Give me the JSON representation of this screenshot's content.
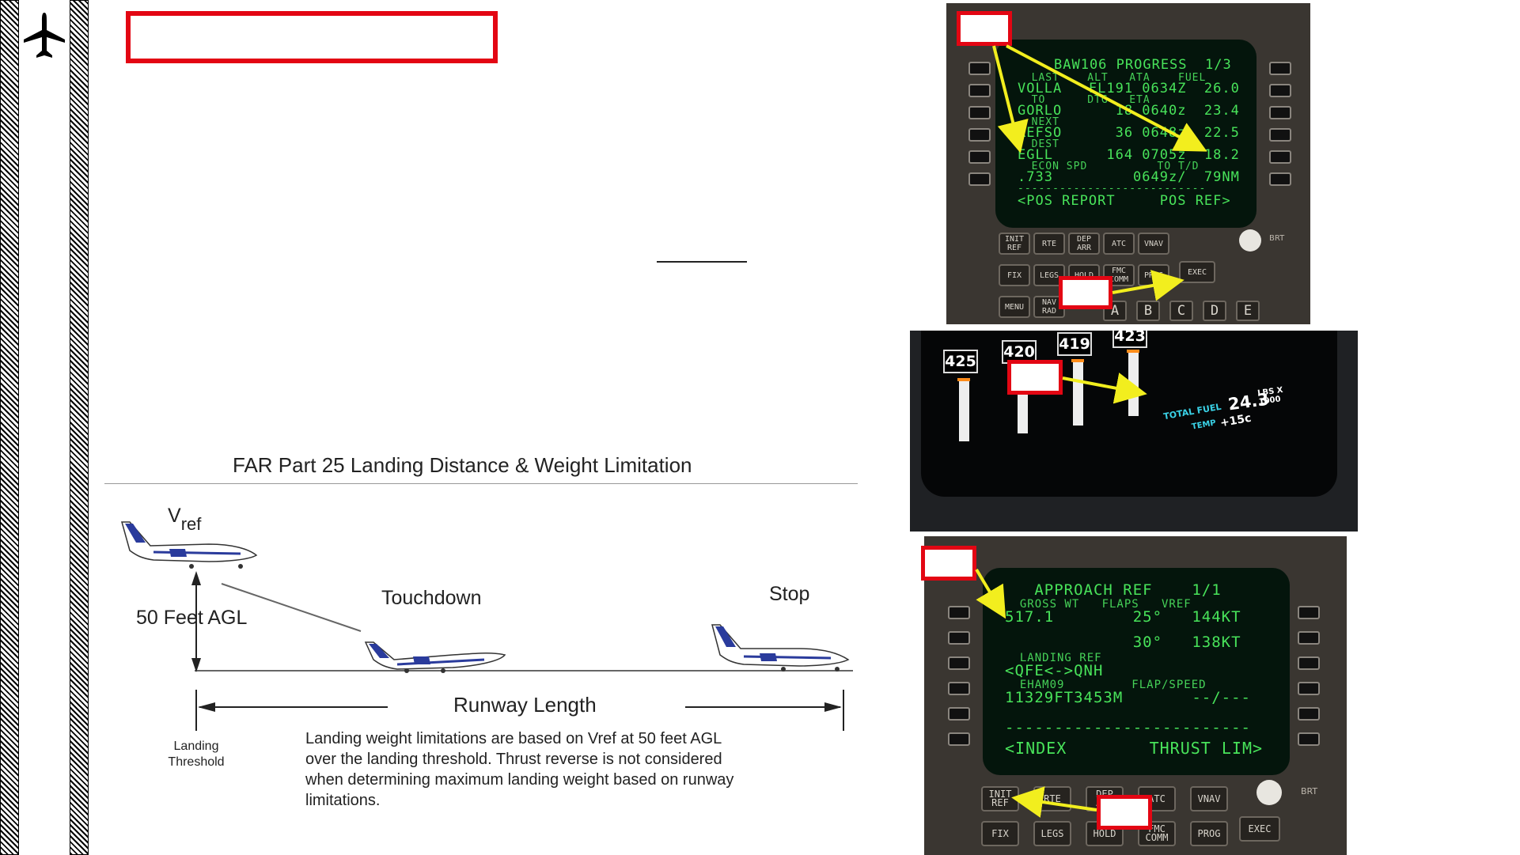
{
  "sidebar": {
    "logo_icon": "airplane-icon"
  },
  "diagram": {
    "title": "FAR Part 25 Landing Distance & Weight Limitation",
    "vref_main": "V",
    "vref_sub": "ref",
    "agl_label": "50 Feet AGL",
    "touchdown_label": "Touchdown",
    "stop_label": "Stop",
    "runway_label": "Runway Length",
    "threshold_label_1": "Landing",
    "threshold_label_2": "Threshold",
    "description": [
      "Landing weight limitations are based on Vref at 50 feet AGL",
      "over the landing threshold.   Thrust reverse is not considered",
      "when determining maximum landing weight based on runway",
      "limitations."
    ]
  },
  "progress_cdu": {
    "lines": [
      {
        "text": "BAW106 PROGRESS  1/3",
        "size": "big"
      },
      {
        "text": "  LAST    ALT   ATA    FUEL",
        "size": "small"
      },
      {
        "text": "VOLLA   FL191 0634Z  26.0",
        "size": "big"
      },
      {
        "text": "  TO      DTG   ETA",
        "size": "small"
      },
      {
        "text": "GORLO      18 0640z  23.4",
        "size": "big"
      },
      {
        "text": "  NEXT",
        "size": "small"
      },
      {
        "text": "REFSO      36 0648z  22.5",
        "size": "big"
      },
      {
        "text": "  DEST",
        "size": "small"
      },
      {
        "text": "EGLL      164 0705z  18.2",
        "size": "big"
      },
      {
        "text": "  ECON SPD          TO T/D",
        "size": "small"
      },
      {
        "text": ".733         0649z/  79NM",
        "size": "big"
      },
      {
        "text": "---------------------------",
        "size": "small"
      },
      {
        "text": "<POS REPORT     POS REF>",
        "size": "big"
      }
    ],
    "keys_row1": [
      "INIT\nREF",
      "RTE",
      "DEP\nARR",
      "ATC",
      "VNAV"
    ],
    "keys_row2": [
      "FIX",
      "LEGS",
      "HOLD",
      "FMC\nCOMM",
      "PROG"
    ],
    "keys_row3": [
      "MENU",
      "NAV\nRAD"
    ],
    "exec_label": "EXEC",
    "brt_label": "BRT",
    "letters": [
      "A",
      "B",
      "C",
      "D",
      "E"
    ]
  },
  "eicas": {
    "fuel_flows": [
      "425",
      "420",
      "419",
      "423"
    ],
    "total_fuel_label": "TOTAL FUEL",
    "total_fuel_value": "24.3",
    "units_1": "LBS X",
    "units_2": "1000",
    "temp_label": "TEMP",
    "temp_value": "+15c"
  },
  "approach_cdu": {
    "lines": [
      {
        "text": "   APPROACH REF    1/1",
        "size": "big"
      },
      {
        "text": "  GROSS WT   FLAPS   VREF",
        "size": "small"
      },
      {
        "text": "517.1        25°   144KT",
        "size": "big"
      },
      {
        "text": " ",
        "size": "small"
      },
      {
        "text": "             30°   138KT",
        "size": "big"
      },
      {
        "text": "  LANDING REF",
        "size": "small"
      },
      {
        "text": "<QFE<->QNH",
        "size": "big"
      },
      {
        "text": "  EHAM09         FLAP/SPEED",
        "size": "small"
      },
      {
        "text": "11329FT3453M       --/---",
        "size": "big"
      },
      {
        "text": " ",
        "size": "small"
      },
      {
        "text": "-------------------------",
        "size": "big"
      },
      {
        "text": "<INDEX        THRUST LIM>",
        "size": "big"
      }
    ],
    "keys_row1": [
      "INIT\nREF",
      "RTE",
      "DEP\nARR",
      "ATC",
      "VNAV"
    ],
    "keys_row2": [
      "FIX",
      "LEGS",
      "HOLD",
      "FMC\nCOMM",
      "PROG"
    ],
    "exec_label": "EXEC",
    "brt_label": "BRT"
  },
  "colors": {
    "highlight": "#e30613",
    "arrow": "#f2ee1e",
    "cdu_text": "#48e35a"
  }
}
